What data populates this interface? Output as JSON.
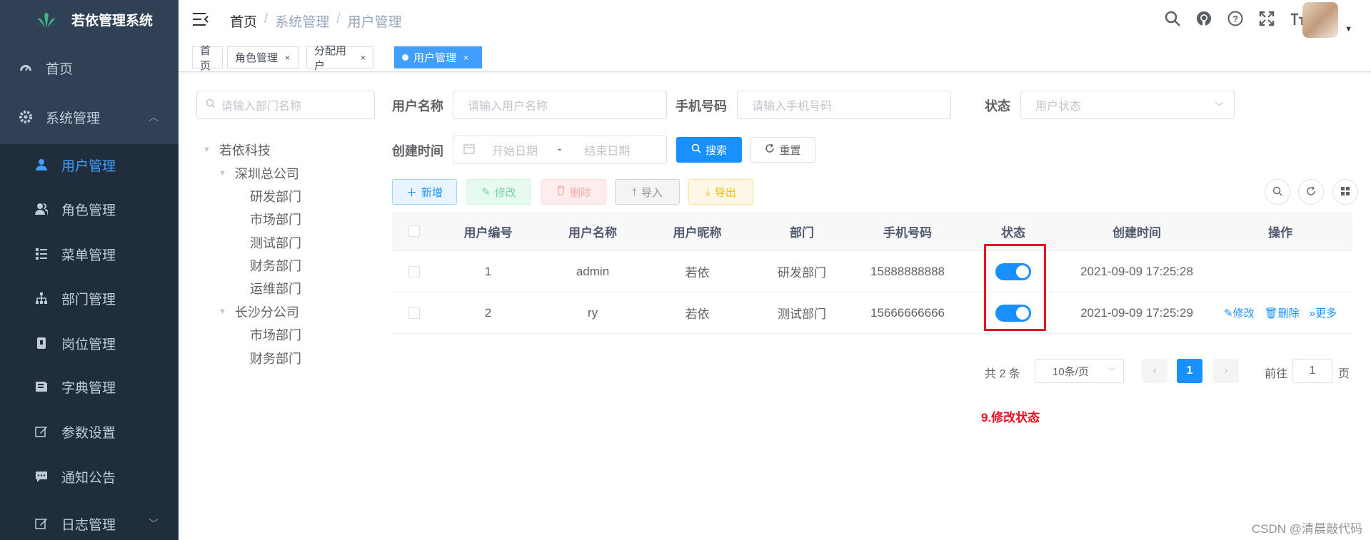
{
  "app": {
    "title": "若依管理系统"
  },
  "sidebar": {
    "home": "首页",
    "system": "系统管理",
    "items": [
      {
        "label": "用户管理",
        "icon": "user-icon"
      },
      {
        "label": "角色管理",
        "icon": "peoples-icon"
      },
      {
        "label": "菜单管理",
        "icon": "tree-table-icon"
      },
      {
        "label": "部门管理",
        "icon": "tree-icon"
      },
      {
        "label": "岗位管理",
        "icon": "post-icon"
      },
      {
        "label": "字典管理",
        "icon": "dict-icon"
      },
      {
        "label": "参数设置",
        "icon": "edit-icon"
      },
      {
        "label": "通知公告",
        "icon": "message-icon"
      }
    ],
    "log": "日志管理"
  },
  "breadcrumb": [
    "首页",
    "系统管理",
    "用户管理"
  ],
  "tags": [
    {
      "label": "首页"
    },
    {
      "label": "角色管理"
    },
    {
      "label": "分配用户"
    },
    {
      "label": "用户管理"
    }
  ],
  "tag_close": "×",
  "dept": {
    "placeholder": "请输入部门名称",
    "tree": {
      "root": "若依科技",
      "branch1": "深圳总公司",
      "branch1_children": [
        "研发部门",
        "市场部门",
        "测试部门",
        "财务部门",
        "运维部门"
      ],
      "branch2": "长沙分公司",
      "branch2_children": [
        "市场部门",
        "财务部门"
      ]
    }
  },
  "search_form": {
    "username_label": "用户名称",
    "username_placeholder": "请输入用户名称",
    "phone_label": "手机号码",
    "phone_placeholder": "请输入手机号码",
    "status_label": "状态",
    "status_placeholder": "用户状态",
    "time_label": "创建时间",
    "start_placeholder": "开始日期",
    "range_sep": "-",
    "end_placeholder": "结束日期",
    "search_btn": "搜索",
    "reset_btn": "重置"
  },
  "toolbar": {
    "add": "新增",
    "edit": "修改",
    "delete": "删除",
    "import": "导入",
    "export": "导出"
  },
  "table": {
    "headers": [
      "用户编号",
      "用户名称",
      "用户昵称",
      "部门",
      "手机号码",
      "状态",
      "创建时间",
      "操作"
    ],
    "rows": [
      {
        "id": "1",
        "username": "admin",
        "nickname": "若依",
        "dept": "研发部门",
        "phone": "15888888888",
        "status_on": true,
        "created": "2021-09-09 17:25:28"
      },
      {
        "id": "2",
        "username": "ry",
        "nickname": "若依",
        "dept": "测试部门",
        "phone": "15666666666",
        "status_on": true,
        "created": "2021-09-09 17:25:29"
      }
    ],
    "op_edit": "修改",
    "op_delete": "删除",
    "op_more": "更多"
  },
  "pagination": {
    "total": "共 2 条",
    "page_size": "10条/页",
    "current_page": "1",
    "goto_prefix": "前往",
    "goto_value": "1",
    "goto_suffix": "页"
  },
  "annotation": "9.修改状态",
  "watermark": "CSDN @清晨敲代码",
  "colors": {
    "sidebar_bg": "#304156",
    "submenu_bg": "#1f2d3d",
    "primary": "#1890ff",
    "highlight": "#e81123"
  }
}
